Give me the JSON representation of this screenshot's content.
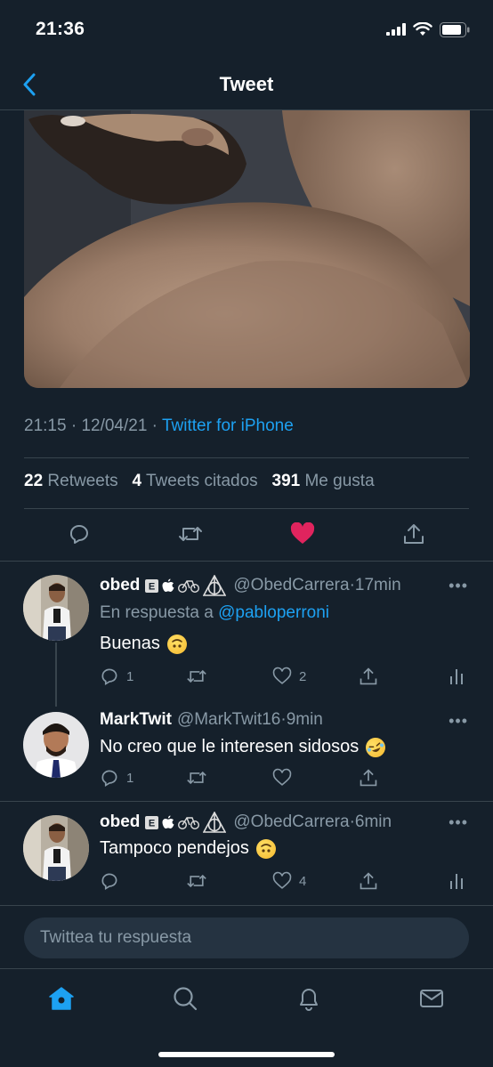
{
  "status_bar": {
    "time": "21:36"
  },
  "nav": {
    "title": "Tweet"
  },
  "tweet": {
    "meta": {
      "time": "21:15",
      "date": "12/04/21",
      "source": "Twitter for iPhone"
    },
    "stats": {
      "retweets_count": "22",
      "retweets_label": "Retweets",
      "quotes_count": "4",
      "quotes_label": "Tweets citados",
      "likes_count": "391",
      "likes_label": "Me gusta"
    }
  },
  "replies": [
    {
      "name": "obed",
      "handle": "@ObedCarrera",
      "time": "17min",
      "reply_to_prefix": "En respuesta a",
      "reply_to": "@pabloperroni",
      "text": "Buenas",
      "emoji": "upside-down-face",
      "reply_count": "1",
      "like_count": "2"
    },
    {
      "name": "MarkTwit",
      "handle": "@MarkTwit16",
      "time": "9min",
      "text": "No creo que le interesen sidosos",
      "emoji": "rolling-on-floor-laughing",
      "reply_count": "1"
    },
    {
      "name": "obed",
      "handle": "@ObedCarrera",
      "time": "6min",
      "text": "Tampoco pendejos",
      "emoji": "upside-down-face",
      "like_count": "4"
    }
  ],
  "compose": {
    "placeholder": "Twittea tu respuesta"
  },
  "colors": {
    "accent": "#1da1f2",
    "background": "#15202b",
    "like": "#e0245e",
    "muted": "#8899a6"
  }
}
